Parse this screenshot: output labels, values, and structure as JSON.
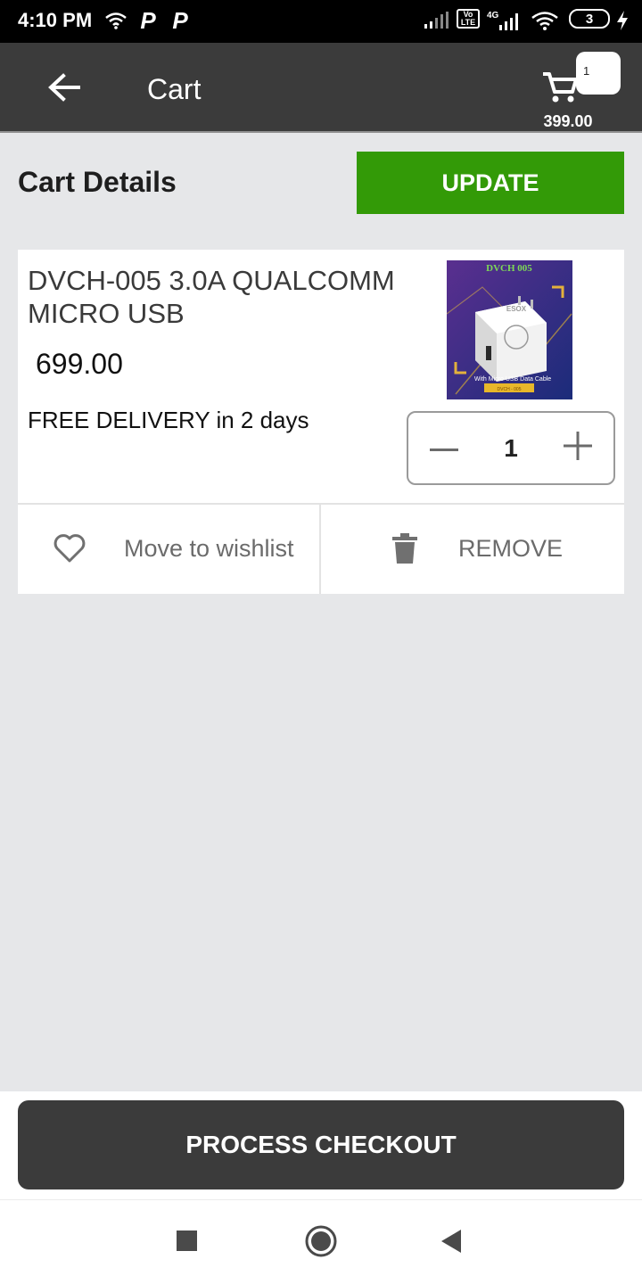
{
  "status_bar": {
    "time": "4:10 PM",
    "volte_line1": "Vo",
    "volte_line2": "LTE",
    "network": "4G",
    "battery": "3",
    "icons": [
      "wifi-icon",
      "p-app-icon",
      "p-app-icon",
      "signal-icon",
      "volte-icon",
      "signal-4g-icon",
      "wifi-icon",
      "battery-icon",
      "charging-icon"
    ]
  },
  "app_bar": {
    "title": "Cart",
    "cart_count": "1",
    "cart_total": "399.00",
    "icons": [
      "back-arrow-icon",
      "cart-icon"
    ]
  },
  "cart": {
    "section_title": "Cart Details",
    "update_label": "UPDATE",
    "item": {
      "name": "DVCH-005 3.0A QUALCOMM MICRO USB",
      "price": "699.00",
      "delivery": "FREE DELIVERY in 2 days",
      "quantity": "1",
      "image": {
        "title": "DVCH 005",
        "brand": "ESOX",
        "caption": "With Micro USB Data Cable",
        "model_label": "DVCH - 005"
      }
    },
    "wishlist_label": "Move to wishlist",
    "remove_label": "REMOVE"
  },
  "checkout": {
    "label": "PROCESS CHECKOUT"
  },
  "nav": {
    "icons": [
      "recents-icon",
      "home-icon",
      "back-icon"
    ]
  },
  "colors": {
    "app_bar": "#3b3b3b",
    "update_button": "#339a07",
    "background": "#e6e7e9"
  }
}
